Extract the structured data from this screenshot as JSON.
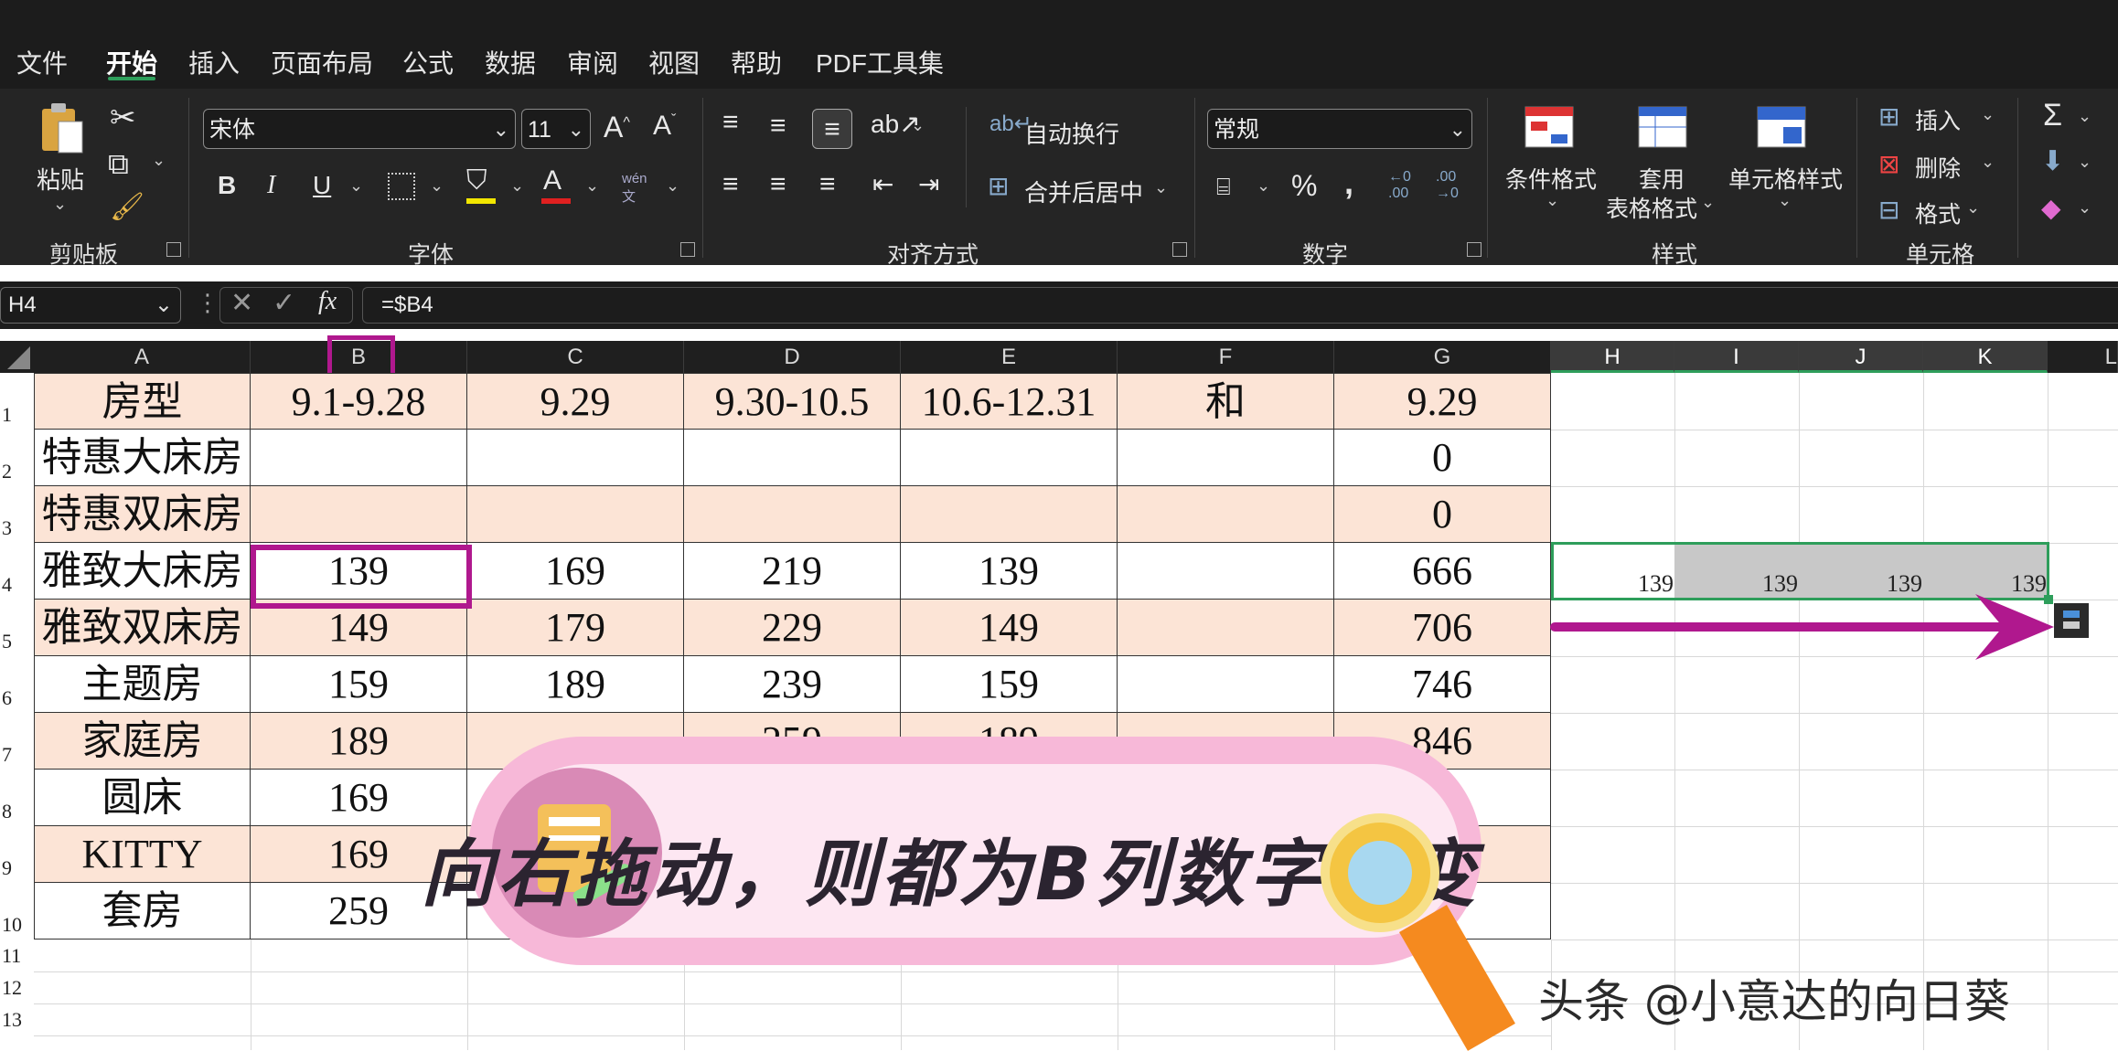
{
  "menu": [
    "文件",
    "开始",
    "插入",
    "页面布局",
    "公式",
    "数据",
    "审阅",
    "视图",
    "帮助",
    "PDF工具集"
  ],
  "active_menu": "开始",
  "ribbon": {
    "clipboard": {
      "paste": "粘贴",
      "label": "剪贴板"
    },
    "font": {
      "name": "宋体",
      "size": "11",
      "label": "字体",
      "bold": "B",
      "italic": "I",
      "underline": "U",
      "grow": "A^",
      "shrink": "Aˇ",
      "phonetic_top": "wén",
      "phonetic_bottom": "文"
    },
    "align": {
      "wrap": "自动换行",
      "merge": "合并后居中",
      "label": "对齐方式"
    },
    "number": {
      "format": "常规",
      "percent": "%",
      "comma": ",",
      "inc_decimal_a": "←0",
      "inc_decimal_b": ".00",
      "dec_decimal_a": ".00",
      "dec_decimal_b": "→0",
      "label": "数字"
    },
    "styles": {
      "cond": "条件格式",
      "table_a": "套用",
      "table_b": "表格格式",
      "cell_style": "单元格样式",
      "label": "样式"
    },
    "cells": {
      "insert": "插入",
      "delete": "删除",
      "format": "格式",
      "label": "单元格"
    }
  },
  "formula_bar": {
    "name_box": "H4",
    "formula": "=$B4",
    "fx": "fx"
  },
  "columns": [
    "A",
    "B",
    "C",
    "D",
    "E",
    "F",
    "G",
    "H",
    "I",
    "J",
    "K",
    "L"
  ],
  "rows": [
    "1",
    "2",
    "3",
    "4",
    "5",
    "6",
    "7",
    "8",
    "9",
    "10",
    "11",
    "12",
    "13"
  ],
  "table": [
    [
      "房型",
      "9.1-9.28",
      "9.29",
      "9.30-10.5",
      "10.6-12.31",
      "和",
      "9.29"
    ],
    [
      "特惠大床房",
      "",
      "",
      "",
      "",
      "",
      "0"
    ],
    [
      "特惠双床房",
      "",
      "",
      "",
      "",
      "",
      "0"
    ],
    [
      "雅致大床房",
      "139",
      "169",
      "219",
      "139",
      "",
      "666"
    ],
    [
      "雅致双床房",
      "149",
      "179",
      "229",
      "149",
      "",
      "706"
    ],
    [
      "主题房",
      "159",
      "189",
      "239",
      "159",
      "",
      "746"
    ],
    [
      "家庭房",
      "189",
      "",
      "259",
      "189",
      "",
      "846"
    ],
    [
      "圆床",
      "169",
      "",
      "",
      "",
      "",
      ""
    ],
    [
      "KITTY",
      "169",
      "",
      "",
      "",
      "",
      ""
    ],
    [
      "套房",
      "259",
      "",
      "",
      "",
      "",
      ""
    ]
  ],
  "h4_values": [
    "139",
    "139",
    "139",
    "139"
  ],
  "banner": "向右拖动，则都为B列数字不变",
  "watermark": "头条 @小意达的向日葵",
  "colors": {
    "accent_green": "#2e9e5b",
    "highlight_magenta": "#b0188e",
    "band": "#fce4d6",
    "banner_pink": "#f7b8d8"
  }
}
